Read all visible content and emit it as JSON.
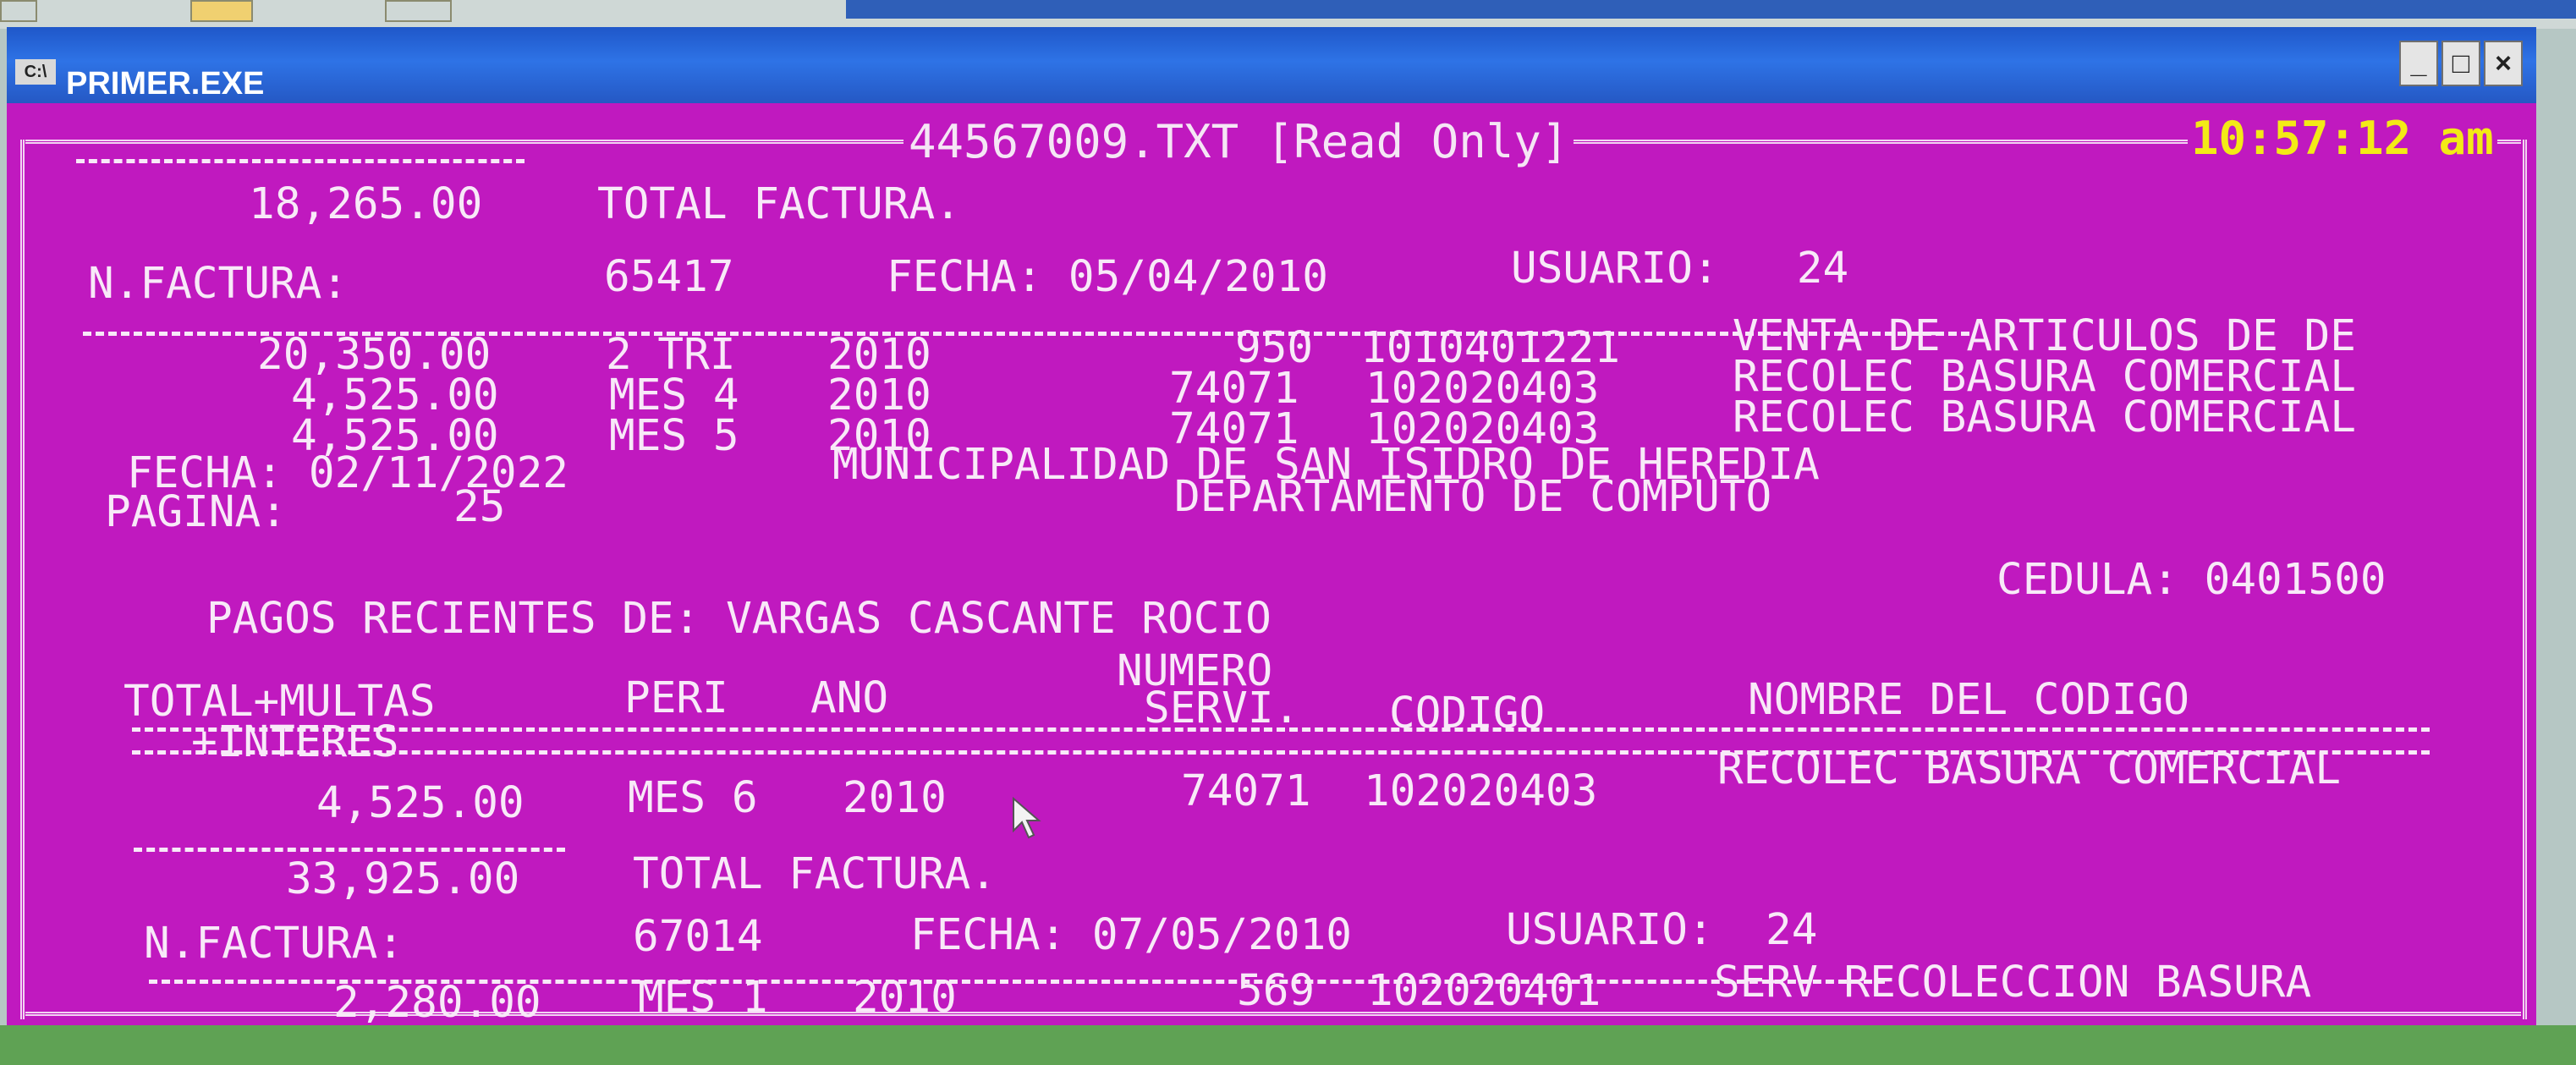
{
  "window": {
    "title": "PRIMER.EXE",
    "icon_label": "C:\\"
  },
  "viewer": {
    "file_title": "44567009.TXT [Read Only]",
    "clock": "10:57:12 am"
  },
  "lines": {
    "total1_amount": "18,265.00",
    "total1_label": "TOTAL FACTURA.",
    "factura1_label": "N.FACTURA:",
    "factura1_number": "65417",
    "factura1_fecha": "FECHA: 05/04/2010",
    "factura1_usuario": "USUARIO:   24",
    "row1_amount": "20,350.00",
    "row1_peri": "2 TRI",
    "row1_ano": "2010",
    "row1_serv": "950",
    "row1_codigo": "1010401221",
    "row1_nombre": "VENTA DE ARTICULOS DE DE",
    "row2_amount": "4,525.00",
    "row2_peri": "MES 4",
    "row2_ano": "2010",
    "row2_serv": "74071",
    "row2_codigo": "102020403",
    "row2_nombre": "RECOLEC BASURA COMERCIAL",
    "row3_amount": "4,525.00",
    "row3_peri": "MES 5",
    "row3_ano": "2010",
    "row3_serv": "74071",
    "row3_codigo": "102020403",
    "row3_nombre": "RECOLEC BASURA COMERCIAL",
    "hdr_fecha": "FECHA: 02/11/2022",
    "hdr_municipalidad": "MUNICIPALIDAD DE SAN ISIDRO DE HEREDIA",
    "hdr_pagina_label": "PAGINA:",
    "hdr_pagina_num": "25",
    "hdr_departamento": "DEPARTAMENTO DE COMPUTO",
    "pagos_recientes": "PAGOS RECIENTES DE: VARGAS CASCANTE ROCIO",
    "cedula": "CEDULA: 0401500",
    "col_total": "TOTAL+MULTAS",
    "col_total2": "+INTERES",
    "col_peri": "PERI",
    "col_ano": "ANO",
    "col_numero": "NUMERO",
    "col_servi": "SERVI.",
    "col_codigo": "CODIGO",
    "col_nombre": "NOMBRE DEL CODIGO",
    "row4_amount": "4,525.00",
    "row4_peri": "MES 6",
    "row4_ano": "2010",
    "row4_serv": "74071",
    "row4_codigo": "102020403",
    "row4_nombre": "RECOLEC BASURA COMERCIAL",
    "total2_amount": "33,925.00",
    "total2_label": "TOTAL FACTURA.",
    "factura2_label": "N.FACTURA:",
    "factura2_number": "67014",
    "factura2_fecha": "FECHA: 07/05/2010",
    "factura2_usuario": "USUARIO:  24",
    "row5_amount": "2,280.00",
    "row5_peri": "MES 1",
    "row5_ano": "2010",
    "row5_serv": "569",
    "row5_codigo": "102020401",
    "row5_nombre": "SERV RECOLECCION BASURA"
  },
  "colors": {
    "console_bg": "#c019bf",
    "text": "#f8e9f8",
    "clock": "#f3ea16",
    "titlebar": "#2e73e6"
  }
}
